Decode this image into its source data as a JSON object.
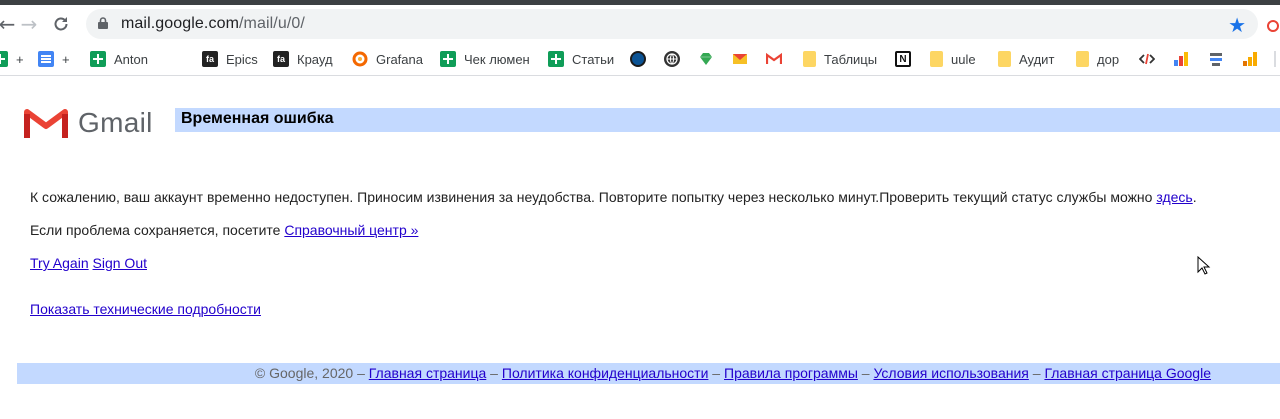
{
  "browser": {
    "url_host": "mail.google.com",
    "url_path": "/mail/u/0/"
  },
  "bookmarks": [
    {
      "label": "+",
      "icon": "google-sheets-icon"
    },
    {
      "label": "+",
      "icon": "google-docs-icon"
    },
    {
      "label": "Anton",
      "icon": "google-sheets-icon"
    },
    {
      "label": "Epics",
      "icon": "fa-icon"
    },
    {
      "label": "Крауд",
      "icon": "fa-icon"
    },
    {
      "label": "Grafana",
      "icon": "fa-icon"
    },
    {
      "label": "Чек люмен",
      "icon": "grafana-icon"
    },
    {
      "label": "Статьи",
      "icon": "google-sheets-icon"
    },
    {
      "label": "Таблицы",
      "icon": "folder-icon"
    },
    {
      "label": "uule",
      "icon": "folder-icon"
    },
    {
      "label": "Аудит",
      "icon": "folder-icon"
    },
    {
      "label": "дор",
      "icon": "folder-icon"
    }
  ],
  "page": {
    "logo_text": "Gmail",
    "title": "Временная ошибка",
    "line1_text": "К сожалению, ваш аккаунт временно недоступен. Приносим извинения за неудобства. Повторите попытку через несколько минут.Проверить текущий статус службы можно ",
    "line1_link": "здесь",
    "line1_end": ".",
    "line2_text": "Если проблема сохраняется, посетите ",
    "line2_link": "Справочный центр »",
    "try_again": "Try Again",
    "sign_out": "Sign Out",
    "tech_details": "Показать технические подробности"
  },
  "footer": {
    "copyright": "© Google, 2020",
    "dash": " – ",
    "links": [
      "Главная страница",
      "Политика конфиденциальности",
      "Правила программы",
      "Условия использования",
      "Главная страница Google"
    ]
  },
  "colors": {
    "title_bar": "#c3d9ff",
    "link": "#2200cc",
    "gmail_red": "#ea4335"
  }
}
